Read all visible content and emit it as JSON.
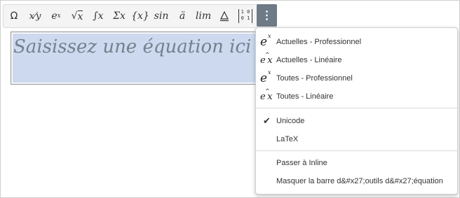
{
  "toolbar": {
    "buttons": {
      "omega": "Ω",
      "fraction": "x⁄y",
      "script_e": "e",
      "script_x": "x",
      "radical_x": "x",
      "integral": "∫x",
      "sum": "Σx",
      "brackets": "{x}",
      "function": "sin",
      "accent": "ä",
      "limit": "lim",
      "matrix_top": "1 0",
      "matrix_bottom": "0 1",
      "more": "⋮"
    },
    "icons": [
      "omega-icon",
      "fraction-icon",
      "script-icon",
      "radical-icon",
      "integral-icon",
      "large-operator-icon",
      "bracket-icon",
      "function-icon",
      "accent-icon",
      "limit-log-icon",
      "operator-icon",
      "matrix-icon",
      "more-options-icon"
    ]
  },
  "equation": {
    "placeholder": "Saisissez une équation ici"
  },
  "menu": {
    "items": [
      {
        "label": "Actuelles - Professionnel",
        "icon": "professional-equation-icon"
      },
      {
        "label": "Actuelles - Linéaire",
        "icon": "linear-equation-icon"
      },
      {
        "label": "Toutes - Professionnel",
        "icon": "professional-equation-icon"
      },
      {
        "label": "Toutes - Linéaire",
        "icon": "linear-equation-icon"
      },
      {
        "label": "Unicode",
        "icon": "check-icon",
        "checked": true
      },
      {
        "label": "LaTeX"
      },
      {
        "label": "Passer à Inline"
      },
      {
        "label": "Masquer la barre d&#x27;outils d&#x27;équation"
      }
    ]
  },
  "colors": {
    "more_button_bg": "#6d7a87",
    "equation_highlight": "#ccd9ef",
    "placeholder_text": "#75808d"
  }
}
